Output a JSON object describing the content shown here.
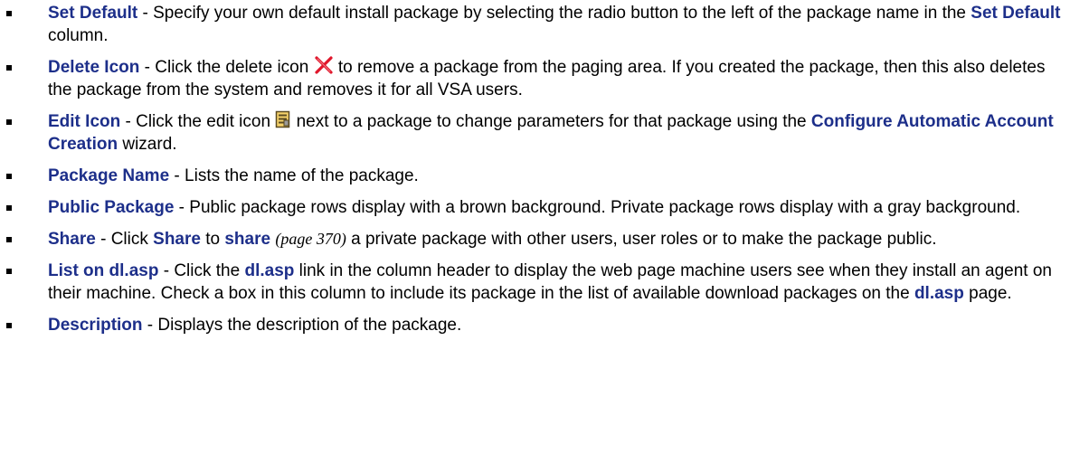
{
  "items": [
    {
      "term": "Set Default",
      "text1": " - Specify your own default install package by selecting the radio button to the left of the package name in the ",
      "term2": "Set Default",
      "text2": " column."
    },
    {
      "term": "Delete Icon",
      "text1": " - Click the delete icon ",
      "icon": "delete-x-icon",
      "text2": " to remove a package from the paging area. If you created the package, then this also deletes the package from the system and removes it for all VSA users."
    },
    {
      "term": "Edit Icon",
      "text1": " - Click the edit icon ",
      "icon": "edit-form-icon",
      "text2": " next to a package to change parameters for that package using the ",
      "term2": "Configure Automatic Account Creation",
      "text3": " wizard."
    },
    {
      "term": "Package Name",
      "text1": " - Lists the name of the package."
    },
    {
      "term": "Public Package",
      "text1": " - Public package rows display with a brown background. Private package rows display with a gray background."
    },
    {
      "term": "Share",
      "text1": " - Click ",
      "term2": "Share",
      "text2": " to ",
      "link": "share",
      "page_ref": "(page 370)",
      "text3": " a private package with other users, user roles or to make the package public."
    },
    {
      "term": "List on dl.asp",
      "text1": " - Click the ",
      "term2": "dl.asp",
      "text2": " link in the column header to display the web page machine users see when they install an agent on their machine. Check a box in this column to include its package in the list of available download packages on the ",
      "term3": "dl.asp",
      "text3": " page."
    },
    {
      "term": "Description",
      "text1": " - Displays the description of the package."
    }
  ],
  "colors": {
    "term": "#1d2f8a",
    "delete_icon": "#e0162b",
    "text": "#000000"
  }
}
